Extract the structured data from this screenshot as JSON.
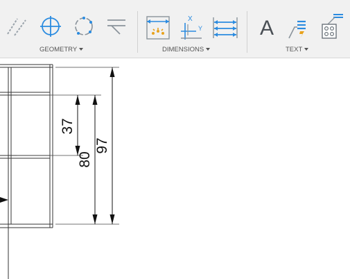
{
  "toolbar": {
    "groups": {
      "geometry": {
        "label": "GEOMETRY"
      },
      "dimensions": {
        "label": "DIMENSIONS"
      },
      "text": {
        "label": "TEXT"
      }
    },
    "tools": {
      "construction_line": {
        "icon": "construction-line-icon"
      },
      "center_mark": {
        "icon": "center-mark-icon"
      },
      "circle_center": {
        "icon": "circle-center-icon"
      },
      "leader_geometry": {
        "icon": "leader-line-icon"
      },
      "linear_dimension": {
        "icon": "linear-dimension-icon"
      },
      "ordinate_dimension": {
        "icon": "ordinate-dimension-icon"
      },
      "baseline_dimension": {
        "icon": "baseline-dimension-icon"
      },
      "text": {
        "label": "A",
        "icon": "text-icon"
      },
      "leader_text": {
        "icon": "leader-text-icon"
      },
      "table": {
        "icon": "hole-table-icon"
      }
    },
    "accent_color": "#2a8be0",
    "secondary_accent": "#e8a21c"
  },
  "drawing": {
    "dimensions": [
      {
        "id": "dim_37",
        "value": "37"
      },
      {
        "id": "dim_80",
        "value": "80"
      },
      {
        "id": "dim_97",
        "value": "97"
      }
    ]
  }
}
